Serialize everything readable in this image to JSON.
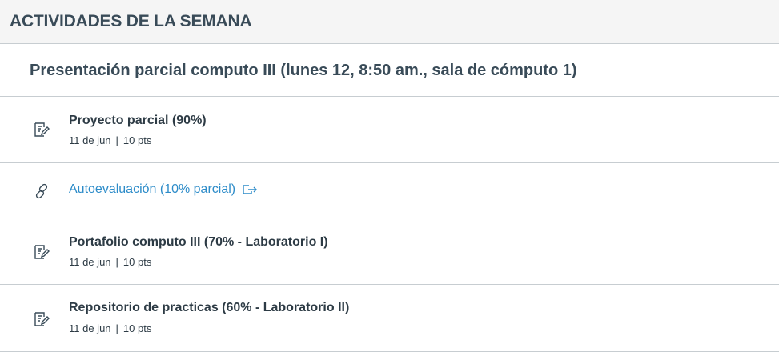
{
  "module": {
    "title": "ACTIVIDADES DE LA SEMANA"
  },
  "subheader": {
    "title": "Presentación parcial computo III (lunes 12, 8:50 am., sala de cómputo 1)"
  },
  "items": [
    {
      "type": "assignment",
      "icon": "assignment-icon",
      "title": "Proyecto parcial (90%)",
      "date": "11 de jun",
      "points": "10 pts"
    },
    {
      "type": "external-link",
      "icon": "link-icon",
      "title": "Autoevaluación (10% parcial)",
      "ext_icon": "external-link-icon"
    },
    {
      "type": "assignment",
      "icon": "assignment-icon",
      "title": "Portafolio computo III (70% - Laboratorio I)",
      "date": "11 de jun",
      "points": "10 pts"
    },
    {
      "type": "assignment",
      "icon": "assignment-icon",
      "title": "Repositorio de practicas (60% - Laboratorio II)",
      "date": "11 de jun",
      "points": "10 pts"
    }
  ],
  "meta_separator": "|",
  "colors": {
    "link": "#2d8cc9",
    "text": "#2d3b45",
    "header_bg": "#f5f5f5",
    "border": "#c7cdd1"
  }
}
